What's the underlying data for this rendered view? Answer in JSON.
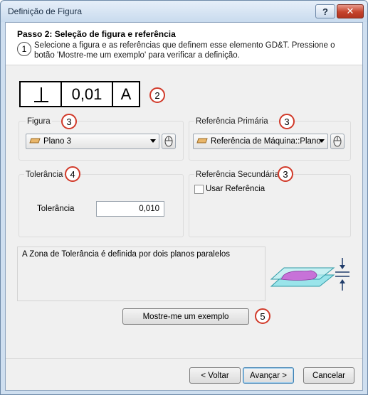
{
  "window": {
    "title": "Definição de Figura",
    "help_label": "?",
    "close_label": "✕"
  },
  "header": {
    "step_title": "Passo 2: Seleção de figura e referência",
    "step_badge": "1",
    "description": "Selecione a figura e as referências que definem esse elemento GD&T. Pressione o botão 'Mostre-me um exemplo' para verificar a definição."
  },
  "frame": {
    "symbol_icon": "perpendicularity-icon",
    "tolerance": "0,01",
    "datum": "A",
    "badge": "2"
  },
  "feature_group": {
    "label": "Figura",
    "badge": "3",
    "selected": "Plano 3",
    "icon": "plane-icon"
  },
  "primary_ref_group": {
    "label": "Referência Primária",
    "badge": "3",
    "selected": "Referência de Máquina::Plano",
    "icon": "plane-icon"
  },
  "tolerance_group": {
    "label": "Tolerância",
    "badge": "4",
    "field_label": "Tolerância",
    "field_value": "0,010"
  },
  "secondary_ref_group": {
    "label": "Referência Secundária",
    "badge": "3",
    "checkbox_label": "Usar Referência",
    "checked": false
  },
  "zone": {
    "description": "A Zona de Tolerância é definida por dois planos paralelos",
    "illustration": "parallel-planes-zone-icon"
  },
  "example_button": {
    "label": "Mostre-me um exemplo",
    "badge": "5"
  },
  "footer": {
    "back_label": "< Voltar",
    "next_label": "Avançar >",
    "cancel_label": "Cancelar"
  },
  "colors": {
    "badge_border": "#d13a2a",
    "window_frame": "#cfdff0",
    "close_button": "#c5432c"
  }
}
